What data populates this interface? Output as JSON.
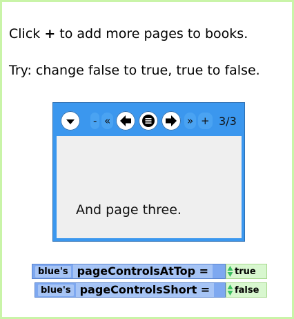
{
  "instructions": {
    "line1_before": "Click",
    "line1_plus": "+",
    "line1_after": "to add more pages to books.",
    "line2": "Try: change false to true, true to false."
  },
  "book": {
    "controls": {
      "minus": "-",
      "first": "«",
      "last": "»",
      "plus": "+",
      "page_count": "3/3"
    },
    "page_text": "And page three."
  },
  "watchers": [
    {
      "owner": "blue's",
      "property": "pageControlsAtTop =",
      "value": "true"
    },
    {
      "owner": "blue's",
      "property": "pageControlsShort =",
      "value": "false"
    }
  ],
  "colors": {
    "frame": "#c9f4a8",
    "book": "#3b97ee",
    "page": "#efefef",
    "watcher_value": "#d8f7cf"
  },
  "icons": [
    "menu-dropdown-icon",
    "back-arrow-icon",
    "page-list-icon",
    "forward-arrow-icon",
    "up-down-arrows-icon"
  ]
}
